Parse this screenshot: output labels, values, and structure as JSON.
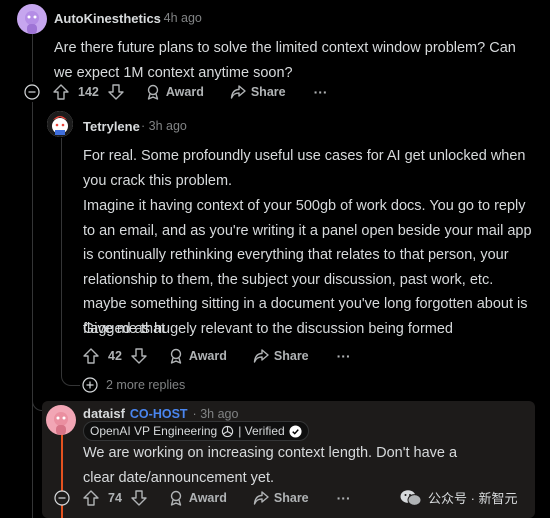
{
  "comments": [
    {
      "username": "AutoKinesthetics",
      "time": "4h ago",
      "body": "Are there future plans to solve the limited context window problem? Can we expect 1M context anytime soon?",
      "votes": "142",
      "award_label": "Award",
      "share_label": "Share",
      "more_label": "···"
    },
    {
      "username": "Tetrylene",
      "time": "3h ago",
      "paragraphs": [
        "For real. Some profoundly useful use cases for AI get unlocked when you crack this problem.",
        "Imagine it having context of your 500gb of work docs. You go to reply to an email, and as you're writing it a panel open beside your mail app is continually rethinking everything that relates to that person, your relationship to them, the subject your discussion, past work, etc. maybe something sitting in a document you've long forgotten about is flagged as hugely relevant to the discussion being formed",
        "Give me that"
      ],
      "votes": "42",
      "award_label": "Award",
      "share_label": "Share",
      "more_label": "···",
      "more_replies": "2 more replies"
    },
    {
      "username": "dataisf",
      "flair": "CO-HOST",
      "time": "3h ago",
      "badge": "OpenAI VP Engineering",
      "verified": "| Verified",
      "body": "We are working on increasing context length. Don't have a clear date/announcement yet.",
      "votes": "74",
      "award_label": "Award",
      "share_label": "Share",
      "more_label": "···"
    }
  ],
  "separator": "·",
  "watermark": "公众号 · 新智元",
  "icons": [
    "upvote-icon",
    "downvote-icon",
    "award-icon",
    "share-icon",
    "collapse-icon",
    "expand-icon",
    "verified-icon",
    "openai-logo-icon",
    "wechat-icon"
  ],
  "colors": {
    "background": "#000000",
    "text": "#d7dadc",
    "muted": "#818384",
    "cohost": "#4a86f0",
    "highlight": "#1d1b1a",
    "active_line": "#e5521f"
  }
}
